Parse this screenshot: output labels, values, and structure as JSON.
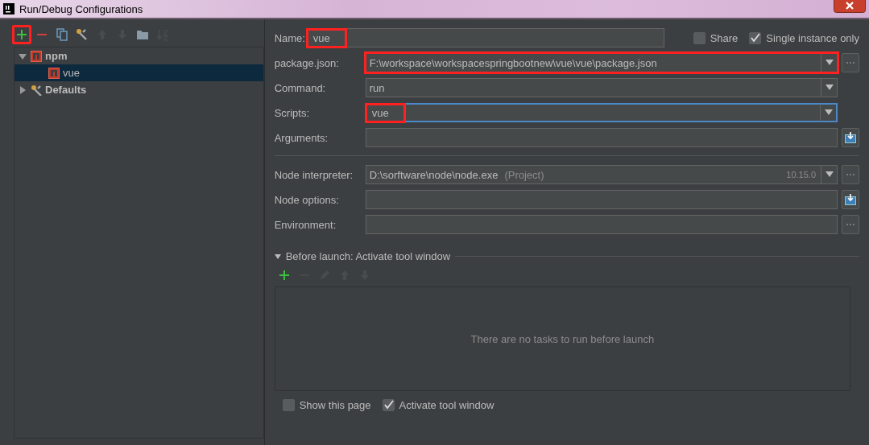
{
  "window": {
    "title": "Run/Debug Configurations"
  },
  "toolbar": [
    {
      "kind": "add",
      "disabled": false,
      "highlighted": true
    },
    {
      "kind": "remove",
      "disabled": false,
      "highlighted": false
    },
    {
      "kind": "copy",
      "disabled": false,
      "highlighted": false
    },
    {
      "kind": "wrench",
      "disabled": false,
      "highlighted": false
    },
    {
      "kind": "up",
      "disabled": true,
      "highlighted": false
    },
    {
      "kind": "down",
      "disabled": true,
      "highlighted": false
    },
    {
      "kind": "folder",
      "disabled": false,
      "highlighted": false
    },
    {
      "kind": "sort",
      "disabled": true,
      "highlighted": false
    }
  ],
  "tree": [
    {
      "label": "npm",
      "kind": "npm",
      "expanded": true,
      "selected": false,
      "children": [
        {
          "label": "vue",
          "kind": "npm",
          "selected": true
        }
      ]
    },
    {
      "label": "Defaults",
      "kind": "wrench",
      "expanded": false,
      "selected": false
    }
  ],
  "name": {
    "label": "Name:",
    "value": "vue",
    "highlighted": true
  },
  "options": [
    {
      "label": "Share",
      "checked": false
    },
    {
      "label": "Single instance only",
      "checked": true
    }
  ],
  "fields": [
    {
      "label": "package.json:",
      "value": "F:\\workspace\\workspacespringbootnew\\vue\\vue\\package.json",
      "kind": "combo",
      "side_button": {
        "kind": "browse"
      },
      "highlighted": true,
      "focused": false
    },
    {
      "label": "Command:",
      "value": "run",
      "kind": "combo",
      "highlighted": false,
      "focused": false
    },
    {
      "label": "Scripts:",
      "value": "vue",
      "kind": "combo",
      "highlighted": true,
      "focused": true
    },
    {
      "label": "Arguments:",
      "kind": "text",
      "side_button": {
        "kind": "expand"
      },
      "highlighted": false,
      "focused": false
    }
  ],
  "node_fields": [
    {
      "label": "Node interpreter:",
      "value": "D:\\sorftware\\node\\node.exe",
      "hint": "(Project)",
      "version": "10.15.0",
      "kind": "combo",
      "side_button": {
        "kind": "browse"
      },
      "highlighted": false,
      "focused": false
    },
    {
      "label": "Node options:",
      "kind": "text",
      "side_button": {
        "kind": "expand"
      },
      "highlighted": false,
      "focused": false
    },
    {
      "label": "Environment:",
      "kind": "text",
      "side_button": {
        "kind": "browse"
      },
      "highlighted": false,
      "focused": false
    }
  ],
  "before_launch": {
    "title": "Before launch: Activate tool window",
    "expanded": true,
    "toolbar": [
      {
        "kind": "add",
        "disabled": false
      },
      {
        "kind": "remove",
        "disabled": true
      },
      {
        "kind": "edit",
        "disabled": true
      },
      {
        "kind": "up",
        "disabled": true
      },
      {
        "kind": "down",
        "disabled": true
      }
    ],
    "empty_text": "There are no tasks to run before launch"
  },
  "bottom_options": [
    {
      "label": "Show this page",
      "checked": false
    },
    {
      "label": "Activate tool window",
      "checked": true
    }
  ]
}
